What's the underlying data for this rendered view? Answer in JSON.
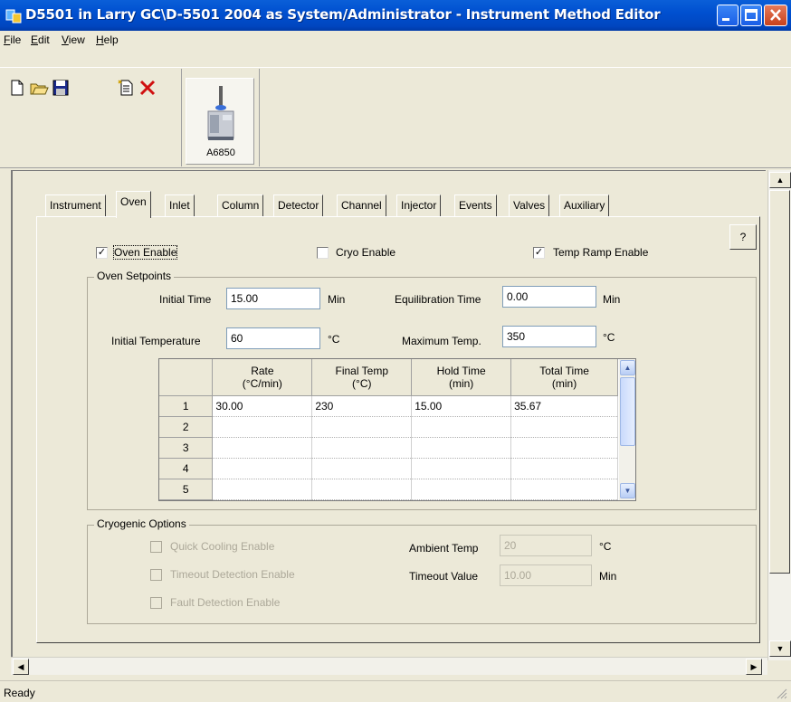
{
  "window": {
    "title": "D5501 in Larry GC\\D-5501 2004 as System/Administrator - Instrument Method Editor"
  },
  "menu": {
    "items": [
      {
        "label": "File",
        "key": "F",
        "rest": "ile"
      },
      {
        "label": "Edit",
        "key": "E",
        "rest": "dit"
      },
      {
        "label": "View",
        "key": "V",
        "rest": "iew"
      },
      {
        "label": "Help",
        "key": "H",
        "rest": "elp"
      }
    ]
  },
  "toolbar": {
    "device_label": "A6850"
  },
  "tabs": [
    {
      "label": "Instrument"
    },
    {
      "label": "Oven"
    },
    {
      "label": "Inlet"
    },
    {
      "label": "Column"
    },
    {
      "label": "Detector"
    },
    {
      "label": "Channel"
    },
    {
      "label": "Injector"
    },
    {
      "label": "Events"
    },
    {
      "label": "Valves"
    },
    {
      "label": "Auxiliary"
    }
  ],
  "active_tab": "Oven",
  "help_label": "?",
  "oven": {
    "oven_enable": {
      "label": "Oven Enable",
      "checked": true
    },
    "cryo_enable": {
      "label": "Cryo Enable",
      "checked": false
    },
    "temp_ramp_enable": {
      "label": "Temp Ramp Enable",
      "checked": true
    },
    "setpoints": {
      "title": "Oven Setpoints",
      "initial_time": {
        "label": "Initial Time",
        "value": "15.00",
        "unit": "Min"
      },
      "equilibration_time": {
        "label": "Equilibration Time",
        "value": "0.00",
        "unit": "Min"
      },
      "initial_temperature": {
        "label": "Initial Temperature",
        "value": "60",
        "unit": "°C"
      },
      "maximum_temp": {
        "label": "Maximum Temp.",
        "value": "350",
        "unit": "°C"
      }
    },
    "ramp_table": {
      "headers": [
        {
          "line1": "Rate",
          "line2": "(°C/min)"
        },
        {
          "line1": "Final Temp",
          "line2": "(°C)"
        },
        {
          "line1": "Hold Time",
          "line2": "(min)"
        },
        {
          "line1": "Total Time",
          "line2": "(min)"
        }
      ],
      "rows": [
        {
          "n": "1",
          "cells": [
            "30.00",
            "230",
            "15.00",
            "35.67"
          ]
        },
        {
          "n": "2",
          "cells": [
            "",
            "",
            "",
            ""
          ]
        },
        {
          "n": "3",
          "cells": [
            "",
            "",
            "",
            ""
          ]
        },
        {
          "n": "4",
          "cells": [
            "",
            "",
            "",
            ""
          ]
        },
        {
          "n": "5",
          "cells": [
            "",
            "",
            "",
            ""
          ]
        }
      ]
    },
    "cryogenic": {
      "title": "Cryogenic Options",
      "quick_cooling": {
        "label": "Quick Cooling Enable",
        "checked": false
      },
      "timeout_detection": {
        "label": "Timeout Detection Enable",
        "checked": false
      },
      "fault_detection": {
        "label": "Fault Detection Enable",
        "checked": false
      },
      "ambient_temp": {
        "label": "Ambient Temp",
        "value": "20",
        "unit": "°C"
      },
      "timeout_value": {
        "label": "Timeout Value",
        "value": "10.00",
        "unit": "Min"
      }
    }
  },
  "status": {
    "text": "Ready"
  }
}
